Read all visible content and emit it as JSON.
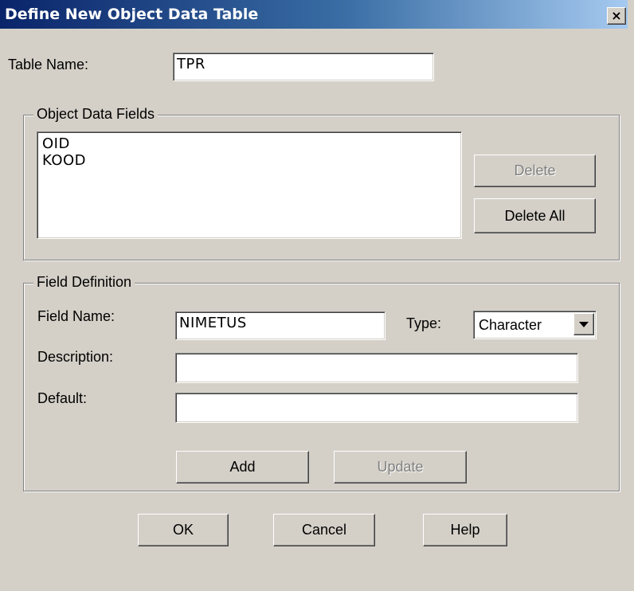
{
  "window": {
    "title": "Define New Object Data Table",
    "close_symbol": "×"
  },
  "table_name": {
    "label": "Table Name:",
    "value": "TPR"
  },
  "object_data_fields": {
    "legend": "Object Data Fields",
    "items": [
      "OID",
      "KOOD"
    ],
    "delete_label": "Delete",
    "delete_all_label": "Delete All"
  },
  "field_definition": {
    "legend": "Field Definition",
    "field_name_label": "Field Name:",
    "field_name_value": "NIMETUS",
    "type_label": "Type:",
    "type_value": "Character",
    "description_label": "Description:",
    "description_value": "",
    "default_label": "Default:",
    "default_value": "",
    "add_label": "Add",
    "update_label": "Update"
  },
  "footer": {
    "ok_label": "OK",
    "cancel_label": "Cancel",
    "help_label": "Help"
  }
}
